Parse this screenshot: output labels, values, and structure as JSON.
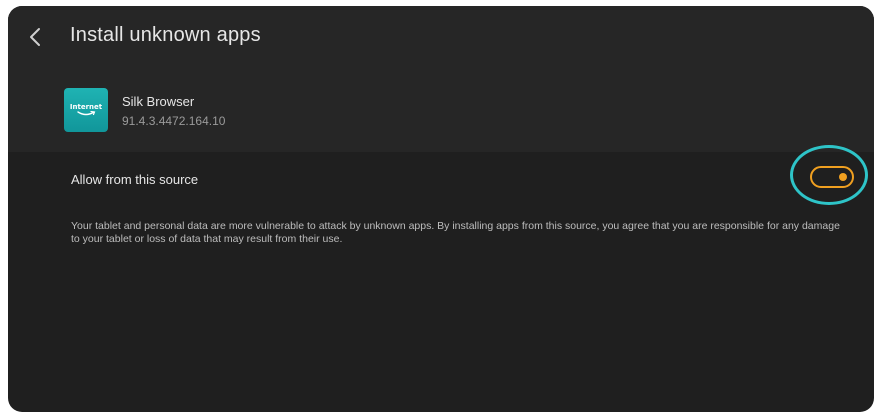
{
  "header": {
    "back_icon": "chevron-left-icon",
    "title": "Install unknown apps"
  },
  "app": {
    "icon_text": "Internet",
    "name": "Silk Browser",
    "version": "91.4.3.4472.164.10"
  },
  "setting": {
    "label": "Allow from this source",
    "toggle_state": "on",
    "toggle_color": "#f0a020",
    "highlight_color": "#2ec4c8"
  },
  "warning": {
    "text": "Your tablet and personal data are more vulnerable to attack by unknown apps. By installing apps from this source, you agree that you are responsible for any damage to your tablet or loss of data that may result from their use."
  }
}
